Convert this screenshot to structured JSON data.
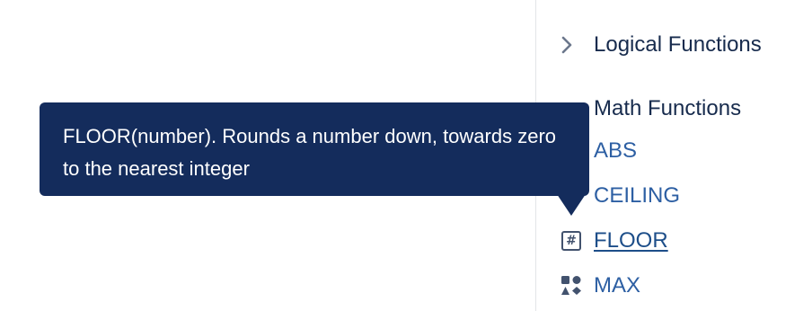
{
  "panel": {
    "groups": [
      {
        "label": "Logical Functions",
        "state": "collapsed",
        "icon": "chevron-right-icon"
      },
      {
        "label": "Math Functions",
        "state": "expanded"
      }
    ],
    "math_functions": [
      {
        "name": "ABS",
        "icon": "function-icon"
      },
      {
        "name": "CEILING",
        "icon": "function-icon"
      },
      {
        "name": "FLOOR",
        "icon": "number-hash-icon",
        "active": true
      },
      {
        "name": "MAX",
        "icon": "shapes-icon"
      }
    ]
  },
  "tooltip": {
    "text": "FLOOR(number). Rounds a number down, towards zero to the nearest integer"
  },
  "colors": {
    "tooltip_bg": "#142c5c",
    "link": "#2d5fa3",
    "heading": "#172b4d",
    "icon": "#42526e"
  }
}
